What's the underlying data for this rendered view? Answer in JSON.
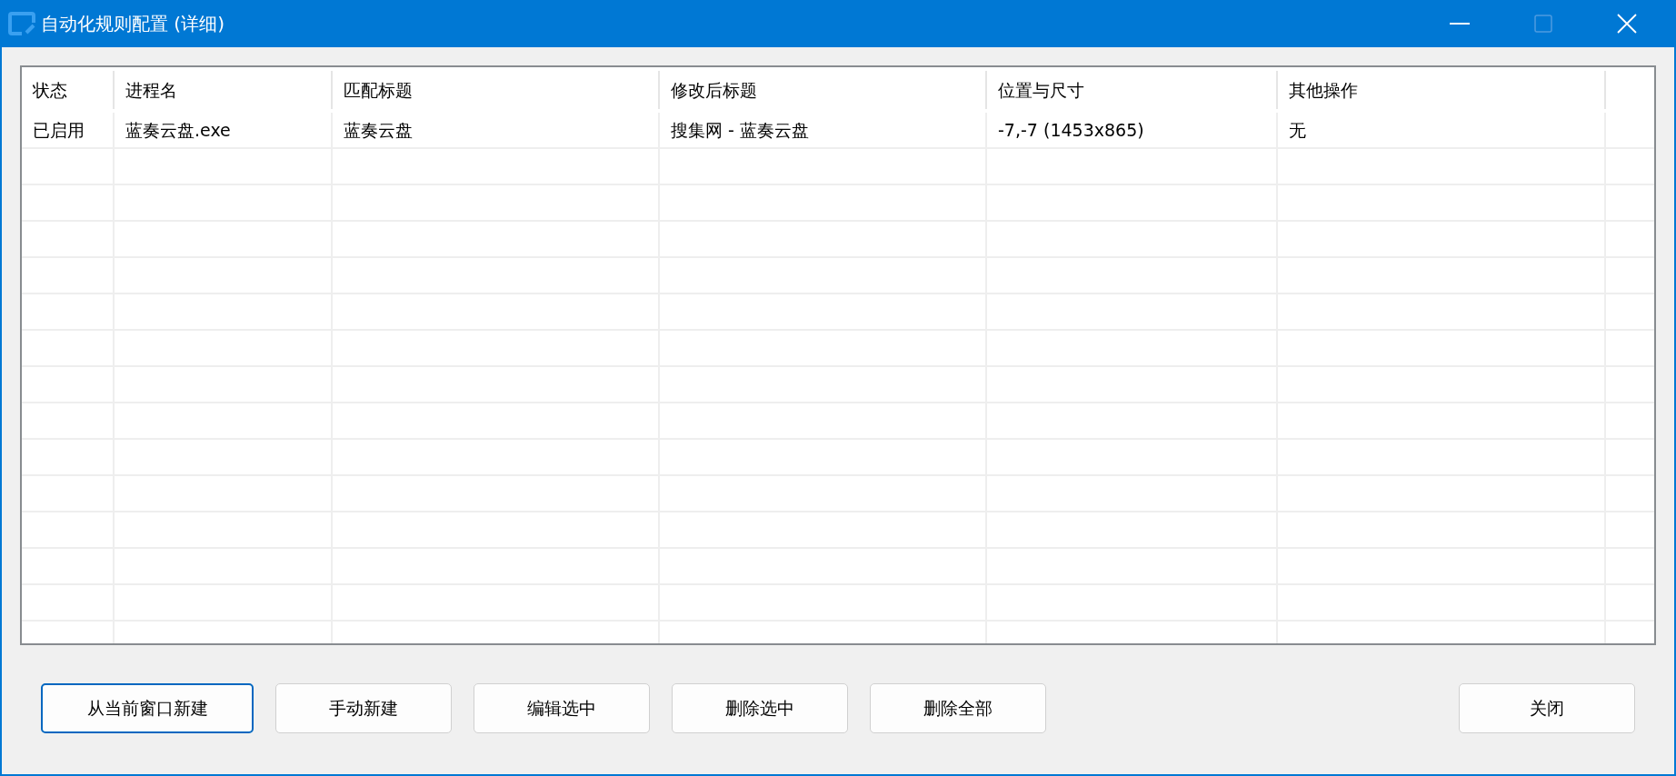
{
  "window": {
    "title": "自动化规则配置 (详细)",
    "controls": [
      {
        "kind": "minimize",
        "disabled": false
      },
      {
        "kind": "maximize",
        "disabled": true
      },
      {
        "kind": "close",
        "disabled": false
      }
    ]
  },
  "table": {
    "columns": [
      "状态",
      "进程名",
      "匹配标题",
      "修改后标题",
      "位置与尺寸",
      "其他操作"
    ],
    "rows": [
      [
        "已启用",
        "蓝奏云盘.exe",
        "蓝奏云盘",
        "搜集网 - 蓝奏云盘",
        "-7,-7 (1453x865)",
        "无"
      ]
    ]
  },
  "buttons": [
    {
      "label": "从当前窗口新建",
      "default": true
    },
    {
      "label": "手动新建",
      "default": false
    },
    {
      "label": "编辑选中",
      "default": false
    },
    {
      "label": "删除选中",
      "default": false
    },
    {
      "label": "删除全部",
      "default": false
    }
  ],
  "close_button": {
    "label": "关闭",
    "default": false
  }
}
